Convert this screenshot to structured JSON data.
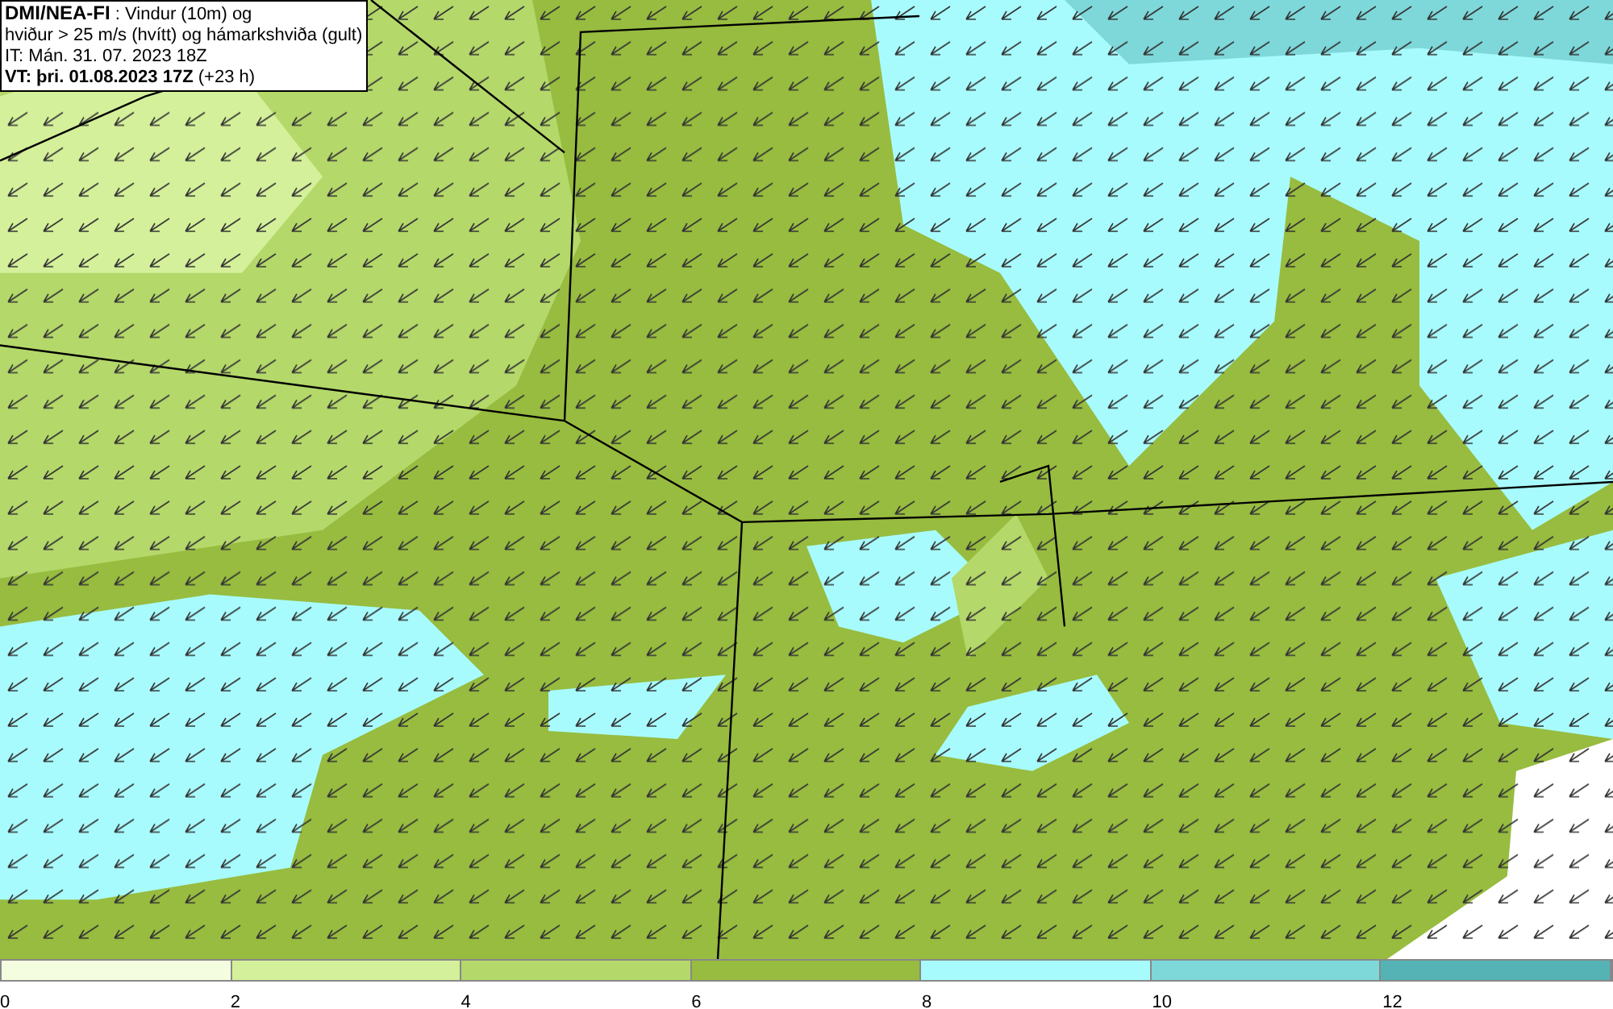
{
  "legend": {
    "source": "DMI/NEA-FI",
    "description": ": Vindur (10m) og",
    "line_2": "hviður > 25 m/s (hvítt) og hámarkshviða (gult)",
    "issue_time": "IT: Mán. 31. 07. 2023 18Z",
    "valid_label": "VT: þri. 01.08.2023 17Z",
    "valid_offset": "(+23 h)"
  },
  "colorbar": [
    {
      "label": "0",
      "color": "#f5fde0"
    },
    {
      "label": "2",
      "color": "#d4f09a"
    },
    {
      "label": "4",
      "color": "#b4d86a"
    },
    {
      "label": "6",
      "color": "#97bc3f"
    },
    {
      "label": "8",
      "color": "#a8fbfd"
    },
    {
      "label": "10",
      "color": "#7ed8da"
    },
    {
      "label": "12",
      "color": "#55b3b5"
    }
  ]
}
